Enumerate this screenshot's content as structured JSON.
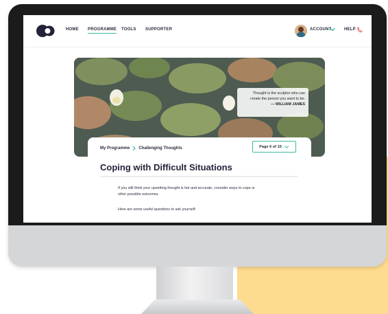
{
  "nav": {
    "links": [
      "HOME",
      "PROGRAMME",
      "TOOLS",
      "SUPPORTER"
    ],
    "active": "PROGRAMME",
    "account_label": "ACCOUNT",
    "help_label": "HELP"
  },
  "banner": {
    "quote_line1": "Thought is the sculptor who can",
    "quote_line2": "create the person you want to be.",
    "quote_author": "— WILLIAM JAMES"
  },
  "content": {
    "breadcrumb_root": "My Programme",
    "breadcrumb_current": "Challenging Thoughts",
    "page_indicator": "Page 6 of 10",
    "title": "Coping with Difficult Situations",
    "paragraph1_line1": "If you still think your upsetting thought is fair and accurate, consider ways to cope or",
    "paragraph1_line2": "other possible outcomes.",
    "paragraph2": "Here are some useful questions to ask yourself:"
  },
  "colors": {
    "accent": "#3bb8a0",
    "nav_text": "#2a2a3c",
    "help_icon": "#e0574f",
    "background_block": "#fddb8f",
    "logo": "#23233a"
  },
  "icons": {
    "logo": "logo-icon",
    "account_caret": "chevron-down-icon",
    "help": "phone-icon",
    "breadcrumb_sep": "chevron-right-icon",
    "page_caret": "chevron-down-icon"
  }
}
